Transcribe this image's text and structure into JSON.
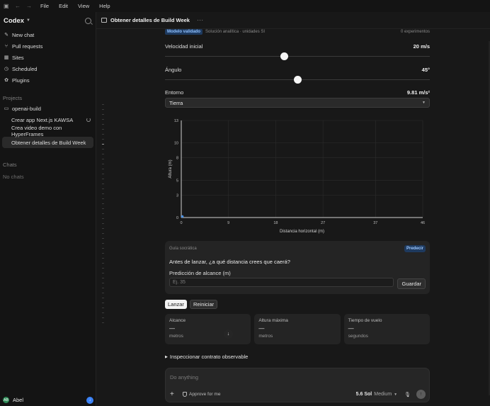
{
  "titlebar": {
    "menus": [
      "File",
      "Edit",
      "View",
      "Help"
    ]
  },
  "sidebar": {
    "brand": "Codex",
    "nav": [
      {
        "label": "New chat",
        "icon": "compose-icon"
      },
      {
        "label": "Pull requests",
        "icon": "pull-request-icon"
      },
      {
        "label": "Sites",
        "icon": "sites-icon"
      },
      {
        "label": "Scheduled",
        "icon": "clock-icon"
      },
      {
        "label": "Plugins",
        "icon": "plugin-icon"
      }
    ],
    "projects_label": "Projects",
    "project_name": "openai-build",
    "threads": [
      {
        "label": "Crear app Next.js KAWSA",
        "running": true
      },
      {
        "label": "Crea video demo con HyperFrames",
        "running": false
      },
      {
        "label": "Obtener detalles de Build Week",
        "active": true
      }
    ],
    "chats_label": "Chats",
    "no_chats": "No chats",
    "user": {
      "name": "Abel",
      "initials": "AB"
    }
  },
  "main": {
    "title": "Obtener detalles de Build Week",
    "more": "···",
    "validated_badge": "Modelo validado",
    "subtitle": "Solución analítica · unidades SI",
    "experiments": "0 experimentos",
    "velocity": {
      "label": "Velocidad inicial",
      "value": "20 m/s",
      "fraction": 0.45
    },
    "angle": {
      "label": "Ángulo",
      "value": "45°",
      "fraction": 0.5
    },
    "environment": {
      "label": "Entorno",
      "value": "9.81 m/s²",
      "selected": "Tierra"
    },
    "guide": {
      "label": "Guía socrática",
      "badge": "Predecir",
      "question": "Antes de lanzar, ¿a qué distancia crees que caerá?",
      "field_label": "Predicción de alcance (m)",
      "placeholder": "Ej. 35",
      "save": "Guardar"
    },
    "launch": "Lanzar",
    "reset": "Reiniciar",
    "stats": [
      {
        "title": "Alcance",
        "value": "—",
        "unit": "metros"
      },
      {
        "title": "Altura máxima",
        "value": "—",
        "unit": "metros"
      },
      {
        "title": "Tiempo de vuelo",
        "value": "—",
        "unit": "segundos"
      }
    ],
    "inspect": "Inspeccionar contrato observable"
  },
  "composer": {
    "placeholder": "Do anything",
    "approve": "Approve for me",
    "model": "5.6 Sol",
    "effort": "Medium"
  },
  "chart_data": {
    "type": "scatter",
    "title": "",
    "xlabel": "Distancia horizontal (m)",
    "ylabel": "Altura (m)",
    "xticks": [
      0,
      9,
      18,
      27,
      37,
      46
    ],
    "yticks": [
      0,
      3,
      5,
      8,
      10,
      13
    ],
    "xlim": [
      0,
      46
    ],
    "ylim": [
      0,
      13
    ],
    "grid": true,
    "series": [
      {
        "x": [
          0
        ],
        "y": [
          0
        ]
      }
    ],
    "colors": {
      "axis": "#cfcfcf",
      "grid": "#2c2c2c",
      "point": "#4a90e2"
    }
  }
}
